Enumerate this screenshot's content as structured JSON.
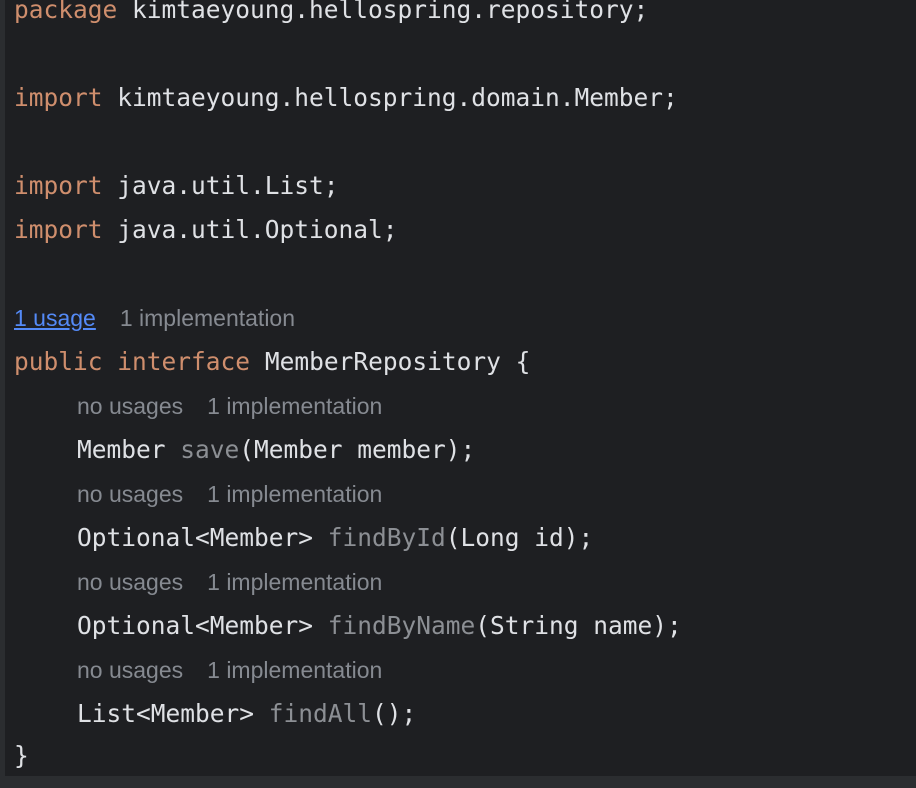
{
  "code": {
    "package_keyword": "package",
    "package_name": "kimtaeyoung.hellospring.repository;",
    "import_keyword": "import",
    "import_member": "kimtaeyoung.hellospring.domain.Member;",
    "import_list": "java.util.List;",
    "import_optional": "java.util.Optional;",
    "interface_hint_usage": "1 usage",
    "interface_hint_impl": "1 implementation",
    "public_keyword": "public",
    "interface_keyword": "interface",
    "interface_decl": "MemberRepository {",
    "closing_brace": "}",
    "methods": [
      {
        "hint_usages": "no usages",
        "hint_impl": "1 implementation",
        "return_type": "Member",
        "name": "save",
        "params": "(Member member);"
      },
      {
        "hint_usages": "no usages",
        "hint_impl": "1 implementation",
        "return_type": "Optional<Member>",
        "name": "findById",
        "params": "(Long id);"
      },
      {
        "hint_usages": "no usages",
        "hint_impl": "1 implementation",
        "return_type": "Optional<Member>",
        "name": "findByName",
        "params": "(String name);"
      },
      {
        "hint_usages": "no usages",
        "hint_impl": "1 implementation",
        "return_type": "List<Member>",
        "name": "findAll",
        "params": "();"
      }
    ]
  },
  "colors": {
    "background": "#1e1f22",
    "text": "#dfe1e5",
    "keyword": "#cf8e6d",
    "method_name": "#8c8f94",
    "hint": "#868a91",
    "link": "#548af7"
  }
}
